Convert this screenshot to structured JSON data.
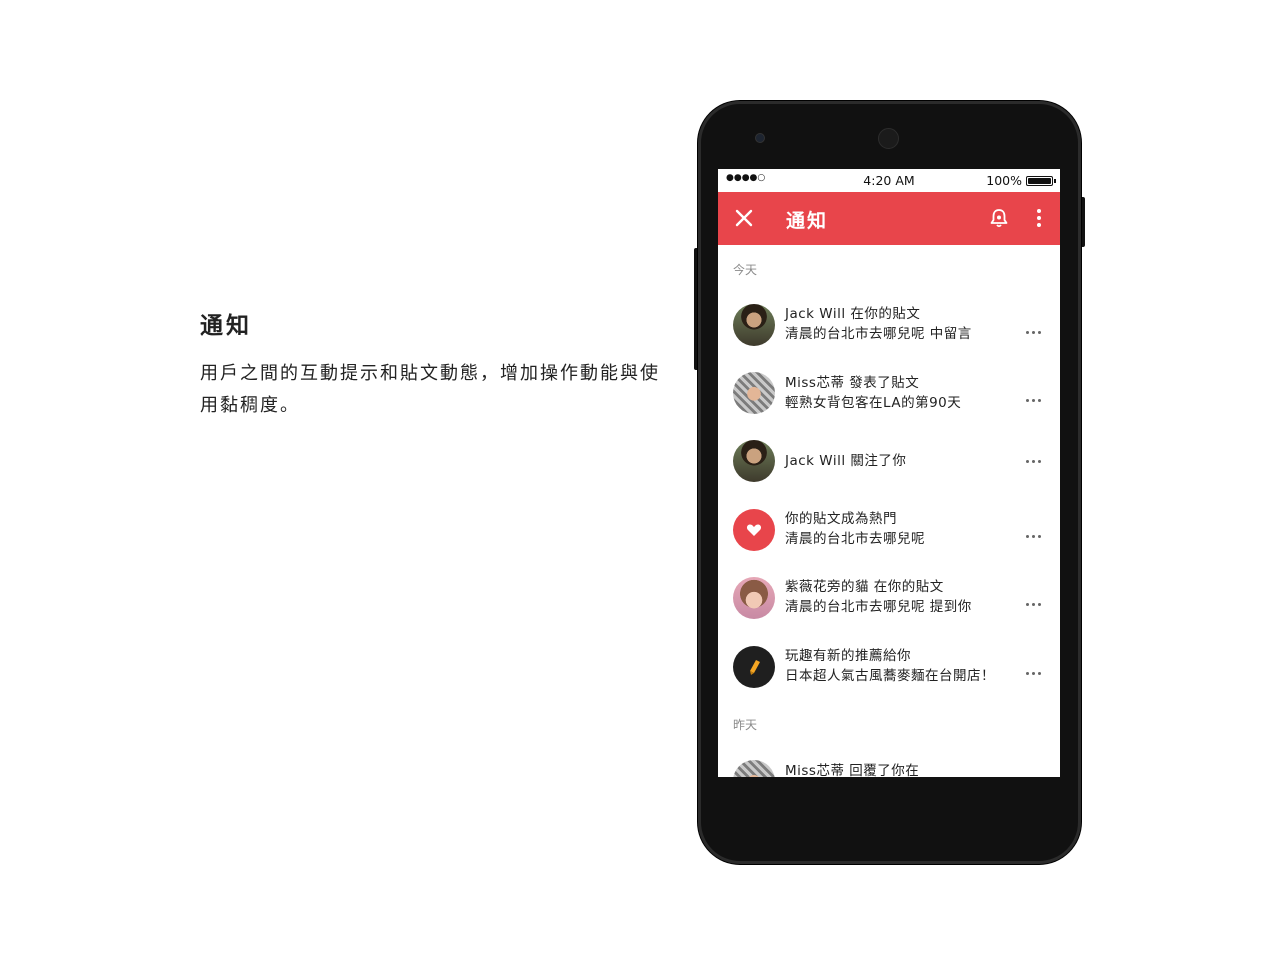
{
  "description": {
    "title": "通知",
    "body": "用戶之間的互動提示和貼文動態，增加操作動能與使用黏稠度。"
  },
  "status_bar": {
    "signal": "●●●●○",
    "time": "4:20 AM",
    "battery": "100%"
  },
  "app_bar": {
    "title": "通知",
    "accent_color": "#e8454b",
    "icons": [
      "close-icon",
      "bell-settings-icon",
      "more-vert-icon"
    ]
  },
  "sections": {
    "today": "今天",
    "yesterday": "昨天"
  },
  "notifications": [
    {
      "avatar": "avatar-photo-man",
      "line1": "Jack Will 在你的貼文",
      "line2": "清晨的台北市去哪兒呢 中留言"
    },
    {
      "avatar": "avatar-photo-woman",
      "line1": "Miss芯蒂 發表了貼文",
      "line2": "輕熟女背包客在LA的第90天"
    },
    {
      "avatar": "avatar-photo-man",
      "line1": "Jack Will 關注了你",
      "line2": ""
    },
    {
      "avatar": "heart-icon",
      "line1": "你的貼文成為熱門",
      "line2": "清晨的台北市去哪兒呢"
    },
    {
      "avatar": "avatar-photo-girl",
      "line1": "紫薇花旁的貓 在你的貼文",
      "line2": "清晨的台北市去哪兒呢 提到你"
    },
    {
      "avatar": "pencil-icon",
      "line1": "玩趣有新的推薦給你",
      "line2": "日本超人氣古風蕎麥麵在台開店！"
    },
    {
      "avatar": "avatar-photo-woman",
      "line1": "Miss芯蒂 回覆了你在",
      "line2": ""
    }
  ]
}
